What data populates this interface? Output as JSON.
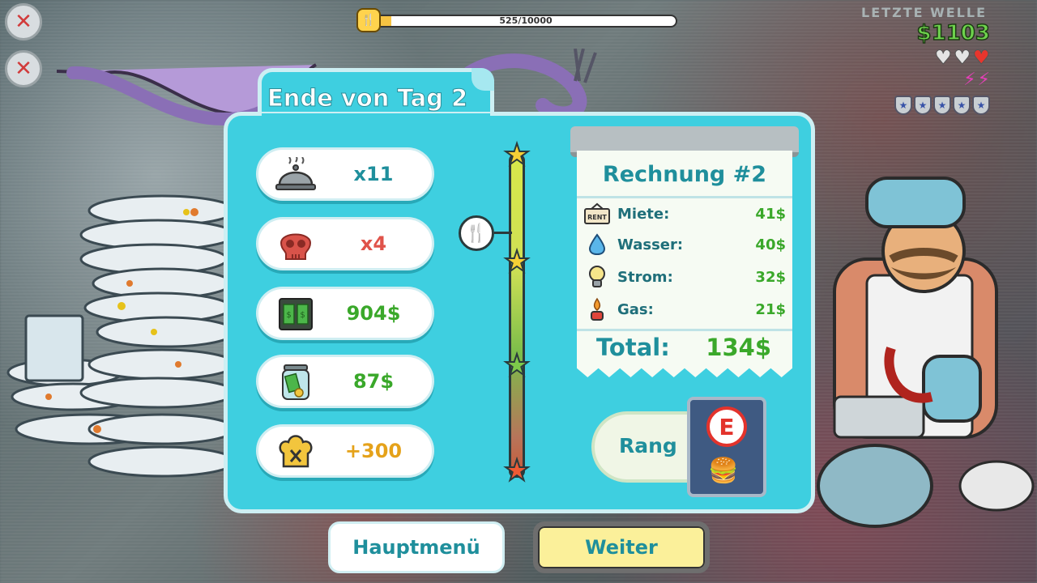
{
  "hud": {
    "progress_text": "525/10000",
    "progress_current": 525,
    "progress_max": 10000,
    "money": "$1103",
    "wave_label": "LETZTE WELLE",
    "hearts": [
      "empty",
      "empty",
      "full"
    ],
    "bolts": 2,
    "badges": 5
  },
  "panel": {
    "title": "Ende von Tag 2"
  },
  "stats": [
    {
      "icon": "cloche-icon",
      "value": "x11",
      "color": "#1f8f9c"
    },
    {
      "icon": "skull-icon",
      "value": "x4",
      "color": "#e0534a"
    },
    {
      "icon": "register-icon",
      "value": "904$",
      "color": "#3aa82a"
    },
    {
      "icon": "tip-jar-icon",
      "value": "87$",
      "color": "#3aa82a"
    },
    {
      "icon": "chef-hat-icon",
      "value": "+300",
      "color": "#e5a21a"
    }
  ],
  "rating": {
    "stars": [
      "love-eyes-star-icon",
      "worried-star-icon",
      "dead-star-icon",
      "angry-star-icon"
    ]
  },
  "receipt": {
    "title": "Rechnung #2",
    "items": [
      {
        "icon": "rent-sign-icon",
        "label": "Miete:",
        "value": "41$"
      },
      {
        "icon": "water-drop-icon",
        "label": "Wasser:",
        "value": "40$"
      },
      {
        "icon": "light-bulb-icon",
        "label": "Strom:",
        "value": "32$"
      },
      {
        "icon": "gas-burner-icon",
        "label": "Gas:",
        "value": "21$"
      }
    ],
    "total_label": "Total:",
    "total_value": "134$"
  },
  "rank": {
    "label": "Rang",
    "grade": "E"
  },
  "buttons": {
    "menu": "Hauptmenü",
    "next": "Weiter"
  }
}
